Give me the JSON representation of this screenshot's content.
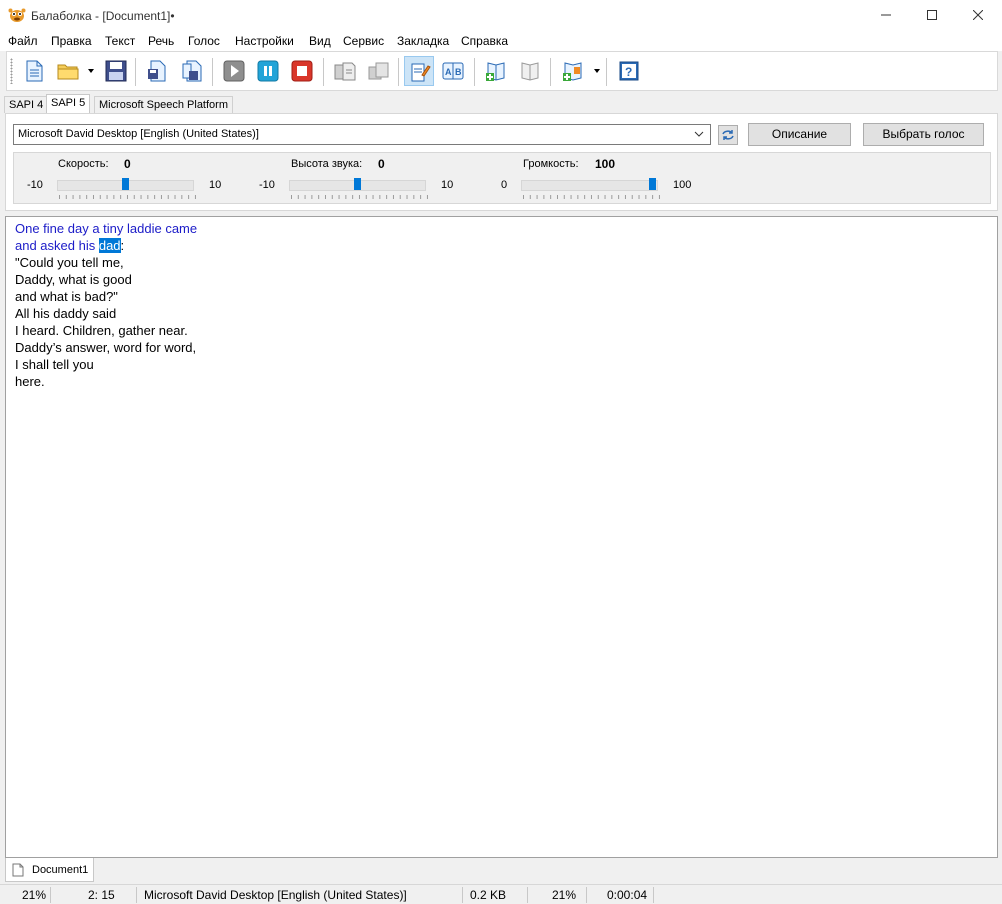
{
  "window": {
    "title": "Балаболка - [Document1]•"
  },
  "menu": [
    "Файл",
    "Правка",
    "Текст",
    "Речь",
    "Голос",
    "Настройки",
    "Вид",
    "Сервис",
    "Закладка",
    "Справка"
  ],
  "tabs": [
    "SAPI 4",
    "SAPI 5",
    "Microsoft Speech Platform"
  ],
  "voice": {
    "selected": "Microsoft David Desktop [English (United States)]",
    "describe_label": "Описание",
    "choose_label": "Выбрать голос"
  },
  "sliders": {
    "speed": {
      "label": "Скорость:",
      "value": "0",
      "min": "-10",
      "max": "10",
      "level": 0.5
    },
    "pitch": {
      "label": "Высота звука:",
      "value": "0",
      "min": "-10",
      "max": "10",
      "level": 0.5
    },
    "volume": {
      "label": "Громкость:",
      "value": "100",
      "min": "0",
      "max": "100",
      "level": 1.0
    }
  },
  "editor": {
    "line1": "One fine day a tiny laddie came",
    "line2_before": "and asked his ",
    "line2_selected": "dad",
    "line2_after": ":",
    "lines": [
      "\"Could you tell me,",
      "Daddy, what is good",
      "and what is bad?\"",
      "All his daddy said",
      "I heard. Children, gather near.",
      "Daddy’s answer, word for word,",
      "I shall tell you",
      "here."
    ]
  },
  "doc_tab": "Document1",
  "status": {
    "zoom": "21%",
    "position": "2:  15",
    "voice": "Microsoft David Desktop [English (United States)]",
    "size": "0.2 KB",
    "progress": "21%",
    "time": "0:00:04"
  },
  "colors": {
    "read_text": "#1c1cc8",
    "selection": "#0078d7",
    "accent": "#0078d7"
  }
}
